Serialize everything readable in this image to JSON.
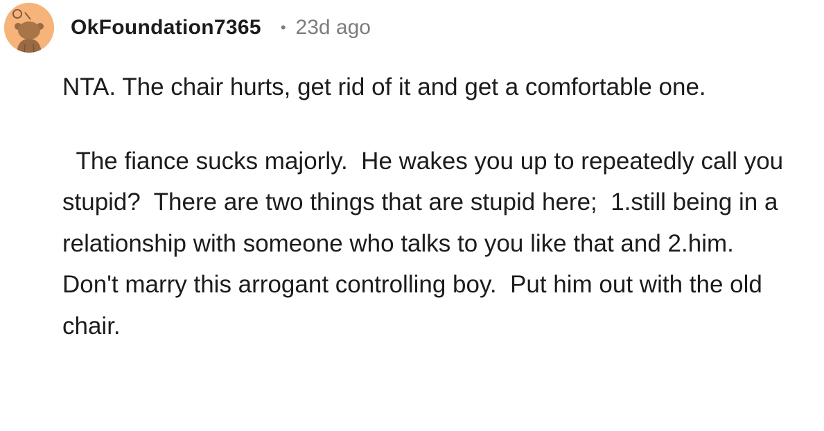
{
  "comment": {
    "author": "OkFoundation7365",
    "separator": "•",
    "time_ago": "23d ago",
    "avatar_icon": "snoo-avatar-icon",
    "avatar_color": "#f6b37a",
    "paragraphs": [
      "NTA. The chair hurts, get rid of it and get a comfortable one.",
      "  The fiance sucks majorly.  He wakes you up to repeatedly call you stupid?  There are two things that are stupid here;  1.still being in a relationship with someone who talks to you like that and 2.him.     Don't marry this arrogant controlling boy.  Put him out with the old chair."
    ]
  }
}
